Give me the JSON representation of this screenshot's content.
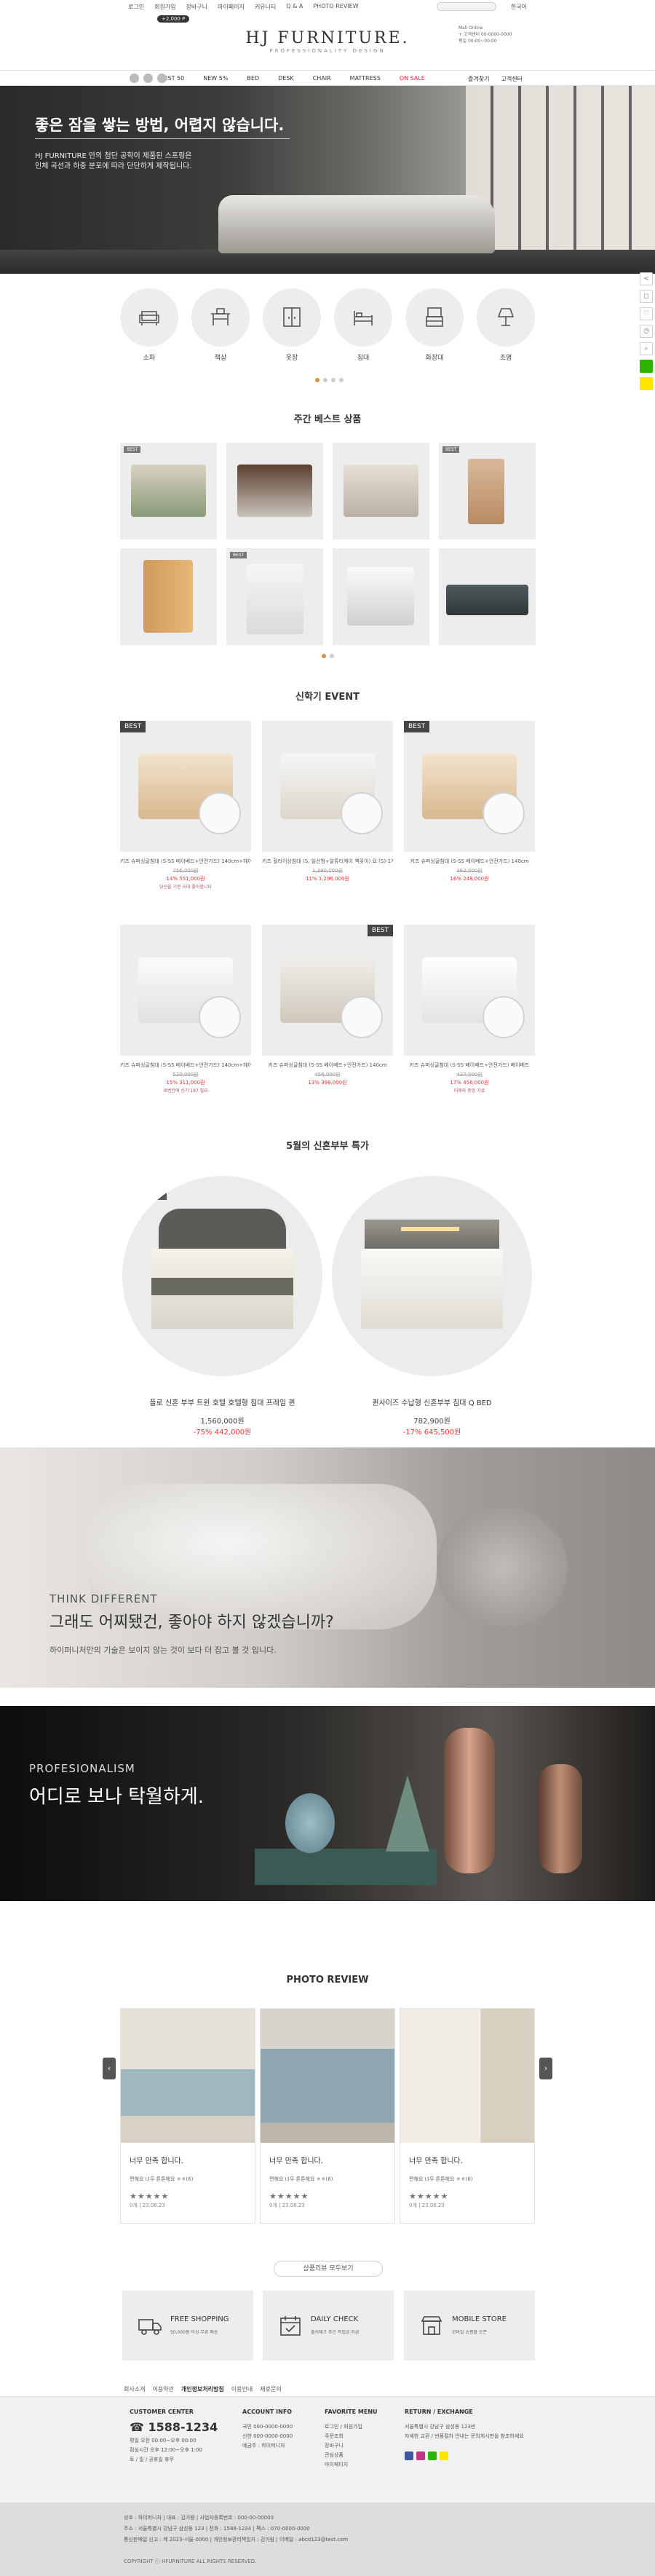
{
  "topbar": {
    "util": [
      "로그인",
      "회원가입",
      "장바구니",
      "마이페이지",
      "커뮤니티",
      "Q & A",
      "PHOTO REVIEW"
    ],
    "lang": "한국어",
    "badge": "+2,000 P"
  },
  "brand": {
    "logo": "HJ FURNITURE.",
    "sub": "PROFESSIONALITY DESIGN"
  },
  "cs_box": "Mall Online\n+ 고객센터 00-0000-0000\n평일 00:00~00:00",
  "nav": {
    "items": [
      "BEST 50",
      "NEW 5%",
      "BED",
      "DESK",
      "CHAIR",
      "MATTRESS",
      "ON SALE"
    ],
    "right": [
      "즐겨찾기",
      "고객센터"
    ]
  },
  "hero": {
    "title": "좋은 잠을 쌓는 방법, 어렵지 않습니다.",
    "desc1": "HJ FURNITURE 만의 첨단 공학이 제품된 스프링은",
    "desc2": "인체 곡선과 하중 분포에 따라 단단하게 제작됩니다."
  },
  "categories": [
    "소파",
    "책상",
    "옷장",
    "침대",
    "화장대",
    "조명"
  ],
  "weekly_best": {
    "heading": "주간 베스트 상품",
    "tag": "BEST"
  },
  "event": {
    "heading": "신학기 EVENT",
    "best": "BEST",
    "items": [
      {
        "name": "키즈 슈퍼싱글침대 (S-SS 베이베드+안전가드) 140cm+헤어 마 하...",
        "orig": "756,000원",
        "price": "14% 551,000원",
        "note": "당신을 기분 오대 좋아합니다"
      },
      {
        "name": "키즈 컬러이상침대 (S, 일선형+알튜티케이 책꽂이) 요 (S)-1개...",
        "orig": "1,380,000원",
        "price": "11% 1,296,000원",
        "note": ""
      },
      {
        "name": "키즈 슈퍼싱글침대 (S-SS 베이베드+안전가드) 140cm",
        "orig": "362,000원",
        "price": "16% 248,000원",
        "note": ""
      },
      {
        "name": "키즈 슈퍼싱글침대 (S-SS 베이베드+안전가드) 140cm+헤어 마...",
        "orig": "520,000원",
        "price": "15% 311,000원",
        "note": "로변칸에 신기 187 필요"
      },
      {
        "name": "키즈 슈퍼싱글침대 (S-SS 베이베드+안전가드) 140cm",
        "orig": "456,000원",
        "price": "13% 398,000원",
        "note": ""
      },
      {
        "name": "키즈 슈퍼싱글침대 (S-SS 베이베드+안전가드) 베이베드",
        "orig": "437,000원",
        "price": "17% 456,000원",
        "note": "미래와 중앙 가료"
      }
    ]
  },
  "newlywed": {
    "heading": "5월의 신혼부부 특가",
    "tag": "본점입에",
    "items": [
      {
        "name": "플로 신혼 부부 트윈 호텔 호텔형 침대 프레임 퀸",
        "orig": "1,560,000원",
        "price": "-75% 442,000원"
      },
      {
        "name": "퀸사이즈 수납형 신혼부부 침대 Q BED",
        "orig": "782,900원",
        "price": "-17% 645,500원"
      }
    ]
  },
  "banner1": {
    "sub": "THINK DIFFERENT",
    "title": "그래도 어찌됐건, 좋아야 하지 않겠습니까?",
    "desc": "하이퍼니처만의 기술은 보이지 않는 것이 보다 더 잡고 볼 것 입니다."
  },
  "banner2": {
    "sub": "PROFESIONALISM",
    "title": "어디로 보나 탁월하게."
  },
  "review": {
    "heading": "PHOTO REVIEW",
    "viewall": "상품리뷰 모두보기",
    "items": [
      {
        "title": "너무 만족 합니다.",
        "desc": "편해요 너무 튼튼해요 ㅎㅎ(6)",
        "stars": "★★★★★",
        "meta": "0개 | 23.06.23"
      },
      {
        "title": "너무 만족 합니다.",
        "desc": "편해요 너무 튼튼해요 ㅎㅎ(6)",
        "stars": "★★★★★",
        "meta": "0개 | 23.06.23"
      },
      {
        "title": "너무 만족 합니다.",
        "desc": "편해요 너무 튼튼해요 ㅎㅎ(6)",
        "stars": "★★★★★",
        "meta": "0개 | 23.06.23"
      }
    ]
  },
  "services": [
    {
      "title": "FREE SHOPPING",
      "desc": "50,000원 이상 무료 배송"
    },
    {
      "title": "DAILY CHECK",
      "desc": "출석체크 주간 적립금 지급"
    },
    {
      "title": "MOBILE STORE",
      "desc": "모바일 쇼핑몰 오픈"
    }
  ],
  "footer_links": [
    "회사소개",
    "이용약관",
    "개인정보처리방침",
    "이용안내",
    "제휴문의"
  ],
  "footer": {
    "cs": {
      "h": "CUSTOMER CENTER",
      "tel": "1588-1234",
      "l1": "평일 오전 00:00~오후 00:00",
      "l2": "점심시간 오후 12:00~오후 1:00",
      "l3": "토 / 일 / 공휴일 휴무"
    },
    "account": {
      "h": "ACCOUNT INFO",
      "l1": "국민 000-0000-0000",
      "l2": "신한 000-0000-0000",
      "l3": "예금주 : 하이퍼니처"
    },
    "menu": {
      "h": "FAVORITE MENU",
      "l1": "로그인 / 회원가입",
      "l2": "주문조회",
      "l3": "장바구니",
      "l4": "관심상품",
      "l5": "마이페이지"
    },
    "ret": {
      "h": "RETURN / EXCHANGE",
      "l1": "서울특별시 강남구 삼성동 123번",
      "l2": "자세한 교환 / 반품절차 안내는 문의게시판을 참조하세요"
    }
  },
  "bottom": {
    "l1": "상호 : 하이퍼니처 | 대표 : 김가람 | 사업자등록번호 : 000-00-00000",
    "l2": "주소 : 서울특별시 강남구 삼성동 123 | 전화 : 1588-1234 | 팩스 : 070-0000-0000",
    "l3": "통신판매업 신고 : 제 2023-서울-0000 | 개인정보관리책임자 : 김가람 | 이메일 : abcd123@test.com",
    "copy": "COPYRIGHT ⓒ HFURNITURE ALL RIGHTS RESERVED."
  },
  "colors": {
    "accent": "#e58b3a",
    "sale": "#e23333"
  }
}
